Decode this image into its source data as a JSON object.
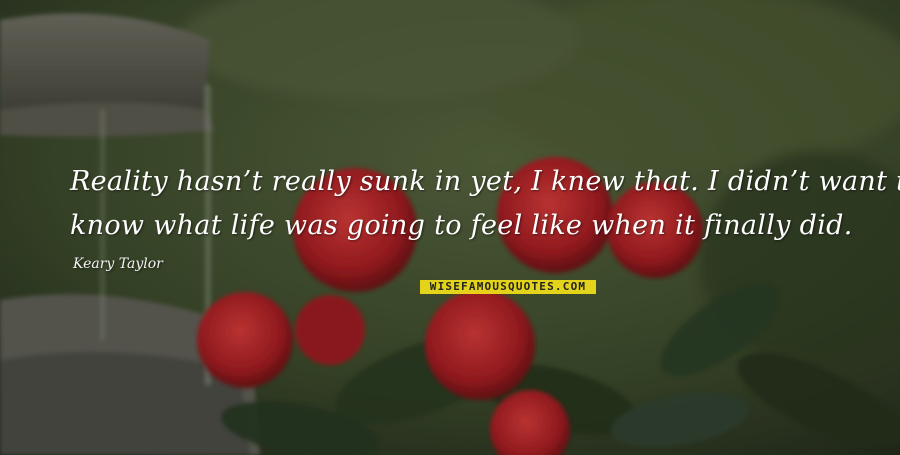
{
  "quote": {
    "line1": "Reality hasn’t really sunk in yet, I knew that. I didn’t want to",
    "line2": "know what life was going to feel like when it finally did.",
    "author": "Keary Taylor"
  },
  "watermark": {
    "text": "WISEFAMOUSQUOTES.COM"
  },
  "colors": {
    "background": "#3a4a2e",
    "flower": "#b8262a",
    "watermark": "#f5e31a",
    "text": "#ffffff"
  }
}
